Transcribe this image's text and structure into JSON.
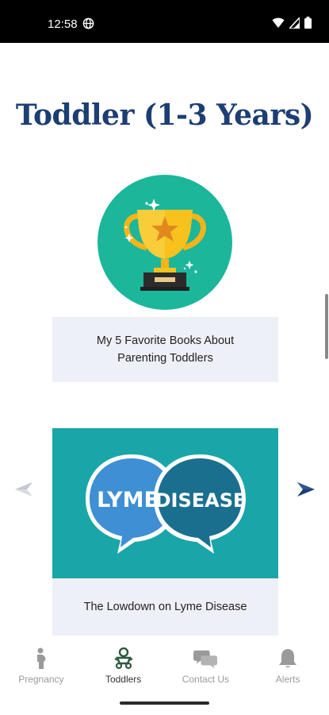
{
  "status_bar": {
    "time": "12:58",
    "icons": [
      "globe-icon",
      "wifi-icon",
      "signal-icon",
      "battery-icon"
    ]
  },
  "page": {
    "title": "Toddler (1-3 Years)"
  },
  "articles": [
    {
      "title": "My 5 Favorite Books About Parenting Toddlers",
      "image_icon": "trophy-icon",
      "image_bg": "#1cb69a"
    },
    {
      "title": "The Lowdown on Lyme Disease",
      "image_text_left": "LYME",
      "image_text_right": "DISEASE",
      "image_bg": "#1aa6a8"
    }
  ],
  "carousel": {
    "prev_icon": "arrow-left-icon",
    "next_icon": "arrow-right-icon"
  },
  "bottom_nav": {
    "items": [
      {
        "label": "Pregnancy",
        "icon": "pregnant-person-icon",
        "active": false
      },
      {
        "label": "Toddlers",
        "icon": "toddler-icon",
        "active": true
      },
      {
        "label": "Contact Us",
        "icon": "chat-bubbles-icon",
        "active": false
      },
      {
        "label": "Alerts",
        "icon": "bell-icon",
        "active": false
      }
    ]
  },
  "colors": {
    "title": "#1d3e72",
    "caption_bg": "#eef0f7",
    "teal": "#1cb69a",
    "nav_inactive": "#9a9a9a",
    "nav_active": "#333333",
    "toddler_icon": "#2b5a40"
  }
}
